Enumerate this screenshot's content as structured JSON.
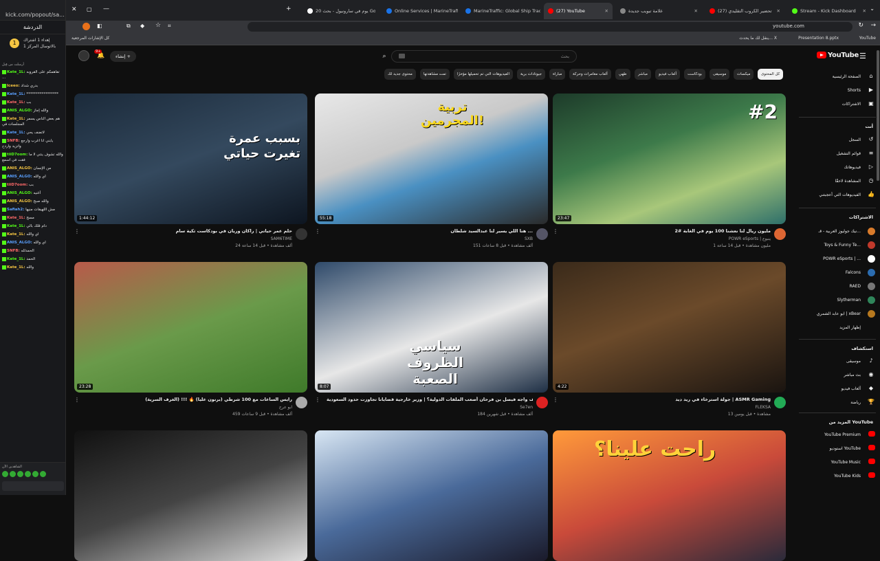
{
  "kick": {
    "url": "kick.com/popout/sa...",
    "chat_title": "الدردشة",
    "pinned": "إهداء 1 اشتراك بالاتوسال المركز 1",
    "pinned_count": "1",
    "replying": "أرسلت من قِبل",
    "messages": [
      {
        "user": "Kate_1L:",
        "text": "تفاهمكم على القروبه ..."
      },
      {
        "user": "Iceeo:",
        "text": "بدري شداد"
      },
      {
        "user": "Kate_1L:",
        "text": "*****************"
      },
      {
        "user": "Kate_1L:",
        "text": "بب"
      },
      {
        "user": "ANIS_ALGO:",
        "text": "والله إجاز"
      },
      {
        "user": "Kate_1L:",
        "text": "هم بعض الناس يسمر المجلسات في"
      },
      {
        "user": "Kate_1L:",
        "text": "لاتضف يحي"
      },
      {
        "user": "SNFB:",
        "text": "يابني انا اغرب وارجع واتزيد واردح"
      },
      {
        "user": "tiiD7oom:",
        "text": "والله تشوف ينتي لا ما فقت في اسمع"
      },
      {
        "user": "ANIS_ALGO:",
        "text": "من الإنسان"
      },
      {
        "user": "ANIS_ALGO:",
        "text": "اي والله"
      },
      {
        "user": "tiiD7oom:",
        "text": "بب"
      },
      {
        "user": "ANIS_ALGO:",
        "text": "أغنيه"
      },
      {
        "user": "ANIS_ALGO:",
        "text": "والله صبح"
      },
      {
        "user": "Safiah2:",
        "text": "مش اللهيقات منيها"
      },
      {
        "user": "Kate_1L:",
        "text": "مسح"
      },
      {
        "user": "Kate_1L:",
        "text": "دام قلك بالي"
      },
      {
        "user": "Kate_1L:",
        "text": "اي والله"
      },
      {
        "user": "ANIS_ALGO:",
        "text": "اي والله"
      },
      {
        "user": "SNFB:",
        "text": "الحمدلله"
      },
      {
        "user": "Kate_1L:",
        "text": "الحمد"
      },
      {
        "user": "Kate_1L:",
        "text": "والله"
      }
    ],
    "chatters": "الشاهدين الآن"
  },
  "browser": {
    "tabs": [
      {
        "label": "Stream - Kick Dashboard",
        "color": "#53fc18"
      },
      {
        "label": "(27) تحضير الكروب التقليدي",
        "color": "#ff0000"
      },
      {
        "label": "علامة تبويب جديدة",
        "color": "#888888"
      },
      {
        "label": "(27) YouTube",
        "color": "#ff0000",
        "active": true
      },
      {
        "label": "MarineTraffic: Global Ship Track",
        "color": "#1a73e8"
      },
      {
        "label": "Online Services | MarineTraffic",
        "color": "#1a73e8"
      },
      {
        "label": "20 يوم في سارونيول - بحث Google",
        "color": "#ffffff"
      }
    ],
    "url": "youtube.com",
    "bookmark_left": "كل الإشارات المرجعية",
    "bookmark_items": [
      "YouTube",
      "Presentation 8.pptx",
      "ينقل لك ما يحدث... X"
    ]
  },
  "youtube": {
    "logo": "YouTube",
    "search_placeholder": "بحث",
    "create_label": "إنشاء",
    "notif_count": "9+",
    "chips": [
      "كل المحتوى",
      "ميكسات",
      "موسيقى",
      "بودكاست",
      "ألعاب فيديو",
      "مباشر",
      "طهي",
      "ألعاب مغامرات وحركة",
      "مباراة",
      "جيوتادات برية",
      "الفيديوهات التي تم تحميلها مؤخرًا",
      "تمت مشاهدتها",
      "محتوى جديد لك"
    ],
    "videos": [
      {
        "title": "مليون ريال لنا نعشنا 100 يوم في الغابة #2",
        "channel": "POWR eSports | ينبوع",
        "stats": "1 مليون مشاهدة • قبل 14 ساعة",
        "duration": "23:47",
        "thumb_text": "#2"
      },
      {
        "title": "هنا اللي يسير لنا عبدالسيد شلطان ...",
        "channel": "SXB",
        "stats": "151 ألف مشاهدة • قبل 8 ساعات",
        "duration": "55:18",
        "thumb_text": "تربية المجرمين!"
      },
      {
        "title": "حلم عمر حياتي | راكان وريان في بودكاست ثكية سام",
        "channel": "SAM6TIME",
        "stats": "24 ألف مشاهدة • قبل 14 ساعة",
        "duration": "1:44:12",
        "thumb_text": "بسبب عمرة تغيرت حياتي"
      },
      {
        "title": "جولة استرخاء في ريد ديد | ASMR Gaming",
        "channel": "FLEKSA",
        "stats": "13 مشاهدة • قبل يومين",
        "duration": "4:22",
        "thumb_text": ""
      },
      {
        "title": "كيف واجه فيصل بن فرحان أصعب الملفات الدولية؟ | وزير خارجية قضايانا تجاوزت حدود السعودية",
        "channel": "Se7en",
        "stats": "184 ألف مشاهدة • قبل شهرين",
        "duration": "8:07",
        "thumb_text": "سياسي الظروف الصعبة"
      },
      {
        "title": "رايس الساعات مع 100 شرطي (برنون عليا) 🔥 !!! (الغرف السرية)",
        "channel": "ابو عرح",
        "stats": "459 ألف مشاهدة • قبل 9 ساعات",
        "duration": "23:28",
        "thumb_text": ""
      },
      {
        "title": "",
        "channel": "",
        "stats": "",
        "duration": "",
        "thumb_text": "راحت علينا؟"
      },
      {
        "title": "",
        "channel": "",
        "stats": "",
        "duration": "",
        "thumb_text": ""
      },
      {
        "title": "",
        "channel": "",
        "stats": "",
        "duration": "",
        "thumb_text": ""
      }
    ],
    "sidebar": {
      "main": [
        {
          "label": "الصفحة الرئيسية",
          "icon": "⌂"
        },
        {
          "label": "Shorts",
          "icon": "▶"
        },
        {
          "label": "الاشتراكات",
          "icon": "▣"
        }
      ],
      "you_header": "أنت",
      "you": [
        {
          "label": "السجل",
          "icon": "↺"
        },
        {
          "label": "قوائم التشغيل",
          "icon": "≡"
        },
        {
          "label": "فيديوهاتك",
          "icon": "▷"
        },
        {
          "label": "المشاهدة لاحقًا",
          "icon": "◷"
        },
        {
          "label": "الفيديوهات التي أعجبتني",
          "icon": "👍"
        }
      ],
      "subs_header": "الاشتراكات",
      "subs": [
        {
          "label": "نيك جوليوز العربية - قـ...",
          "color": "#d97b2b"
        },
        {
          "label": "Toys & Funny Te...",
          "color": "#c0392b"
        },
        {
          "label": "POWR eSports | ...",
          "color": "#ffffff"
        },
        {
          "label": "Falcons",
          "color": "#2b6cb0"
        },
        {
          "label": "RAED",
          "color": "#777777"
        },
        {
          "label": "Slytherman",
          "color": "#2f855a"
        },
        {
          "label": "ابو عابد الشمري | xBear",
          "color": "#b7791f"
        },
        {
          "label": "إظهار المزيد",
          "color": ""
        }
      ],
      "explore_header": "استكشاف",
      "explore": [
        {
          "label": "موسيقى",
          "icon": "♪"
        },
        {
          "label": "بث مباشر",
          "icon": "◉"
        },
        {
          "label": "ألعاب فيديو",
          "icon": "◆"
        },
        {
          "label": "رياضة",
          "icon": "🏆"
        }
      ],
      "more_header": "المزيد من YouTube",
      "more": [
        {
          "label": "YouTube Premium"
        },
        {
          "label": "استوديو YouTube"
        },
        {
          "label": "YouTube Music"
        },
        {
          "label": "YouTube Kids"
        }
      ]
    }
  }
}
